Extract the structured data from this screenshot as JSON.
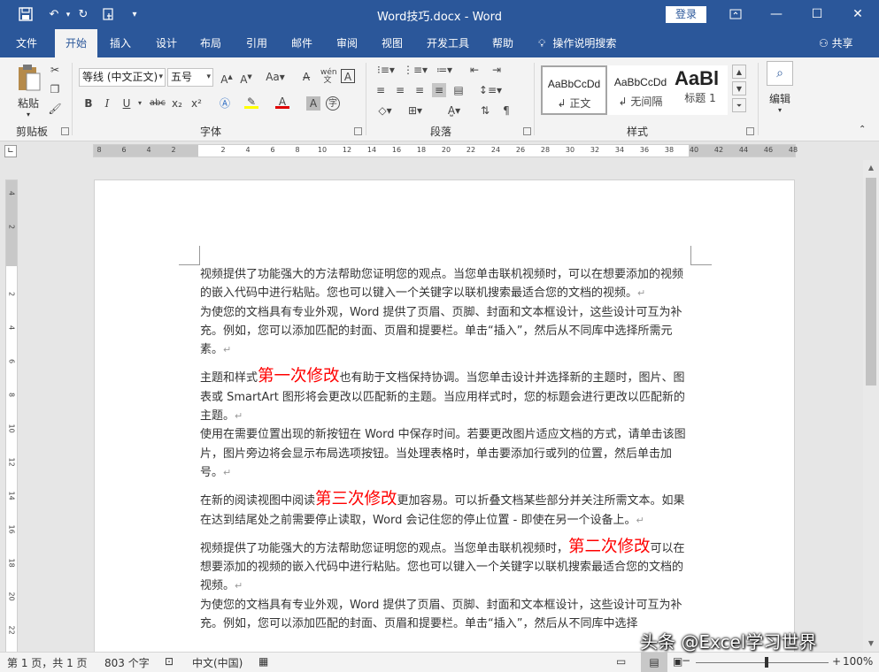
{
  "titlebar": {
    "title": "Word技巧.docx  -  Word",
    "login_label": "登录",
    "icons": [
      "save-icon",
      "undo-icon",
      "redo-icon",
      "touch-mode-icon",
      "customize-qat-icon"
    ]
  },
  "tabs": {
    "items": [
      "文件",
      "开始",
      "插入",
      "设计",
      "布局",
      "引用",
      "邮件",
      "审阅",
      "视图",
      "开发工具",
      "帮助"
    ],
    "active": "开始",
    "tell_me": "操作说明搜索",
    "share": "共享"
  },
  "ribbon": {
    "clipboard": {
      "label": "剪贴板",
      "paste": "粘贴"
    },
    "font": {
      "label": "字体",
      "font_name": "等线 (中文正文)",
      "font_size": "五号",
      "bold": "B",
      "italic": "I",
      "underline": "U",
      "strike": "abc",
      "subscript": "x₂",
      "superscript": "x²",
      "pinyin": "wén",
      "border_char": "A",
      "enclose_char": "字",
      "font_color": "#e00000",
      "highlight_color": "#ffff00"
    },
    "paragraph": {
      "label": "段落"
    },
    "styles": {
      "label": "样式",
      "items": [
        {
          "sample": "AaBbCcDd",
          "name": "正文"
        },
        {
          "sample": "AaBbCcDd",
          "name": "无间隔"
        },
        {
          "sample": "AaBl",
          "name": "标题 1"
        }
      ]
    },
    "editing": {
      "label": "编辑"
    }
  },
  "ruler": {
    "h_numbers": [
      "8",
      "6",
      "4",
      "2",
      "",
      "2",
      "4",
      "6",
      "8",
      "10",
      "12",
      "14",
      "16",
      "18",
      "20",
      "22",
      "24",
      "26",
      "28",
      "30",
      "32",
      "34",
      "36",
      "38",
      "40",
      "42",
      "44",
      "46",
      "48"
    ],
    "v_numbers": [
      "4",
      "2",
      "",
      "2",
      "4",
      "6",
      "8",
      "10",
      "12",
      "14",
      "16",
      "18",
      "20",
      "22"
    ]
  },
  "document": {
    "paragraphs": [
      {
        "parts": [
          {
            "text": "视频提供了功能强大的方法帮助您证明您的观点。当您单击联机视频时，可以在想要添加的视频的嵌入代码中进行粘贴。您也可以键入一个关键字以联机搜索最适合您的文档的视频。"
          },
          {
            "text": "↵",
            "mark": true
          }
        ]
      },
      {
        "parts": [
          {
            "text": "为使您的文档具有专业外观，Word 提供了页眉、页脚、封面和文本框设计，这些设计可互为补充。例如，您可以添加匹配的封面、页眉和提要栏。单击“插入”，然后从不同库中选择所需元素。"
          },
          {
            "text": "↵",
            "mark": true
          }
        ]
      },
      {
        "gap": true,
        "parts": [
          {
            "text": "主题和样式"
          },
          {
            "text": "第一次修改",
            "red": true
          },
          {
            "text": "也有助于文档保持协调。当您单击设计并选择新的主题时，图片、图表或 SmartArt 图形将会更改以匹配新的主题。当应用样式时，您的标题会进行更改以匹配新的主题。"
          },
          {
            "text": "↵",
            "mark": true
          }
        ]
      },
      {
        "parts": [
          {
            "text": "使用在需要位置出现的新按钮在 Word 中保存时间。若要更改图片适应文档的方式，请单击该图片，图片旁边将会显示布局选项按钮。当处理表格时，单击要添加行或列的位置，然后单击加号。"
          },
          {
            "text": "↵",
            "mark": true
          }
        ]
      },
      {
        "gap": true,
        "parts": [
          {
            "text": "在新的阅读视图中阅读"
          },
          {
            "text": "第三次修改",
            "red": true
          },
          {
            "text": "更加容易。可以折叠文档某些部分并关注所需文本。如果在达到结尾处之前需要停止读取，Word 会记住您的停止位置 - 即使在另一个设备上。"
          },
          {
            "text": "↵",
            "mark": true
          }
        ]
      },
      {
        "gap": true,
        "parts": [
          {
            "text": "视频提供了功能强大的方法帮助您证明您的观点。当您单击联机视频时，"
          },
          {
            "text": "第二次修改",
            "red": true
          },
          {
            "text": "可以在想要添加的视频的嵌入代码中进行粘贴。您也可以键入一个关键字以联机搜索最适合您的文档的视频。"
          },
          {
            "text": "↵",
            "mark": true
          }
        ]
      },
      {
        "parts": [
          {
            "text": "为使您的文档具有专业外观，Word 提供了页眉、页脚、封面和文本框设计，这些设计可互为补充。例如，您可以添加匹配的封面、页眉和提要栏。单击“插入”，然后从不同库中选择"
          }
        ]
      }
    ]
  },
  "statusbar": {
    "page": "第 1 页，共 1 页",
    "words": "803 个字",
    "language": "中文(中国)",
    "zoom": "100%"
  },
  "watermark": "头条 @Excel学习世界"
}
